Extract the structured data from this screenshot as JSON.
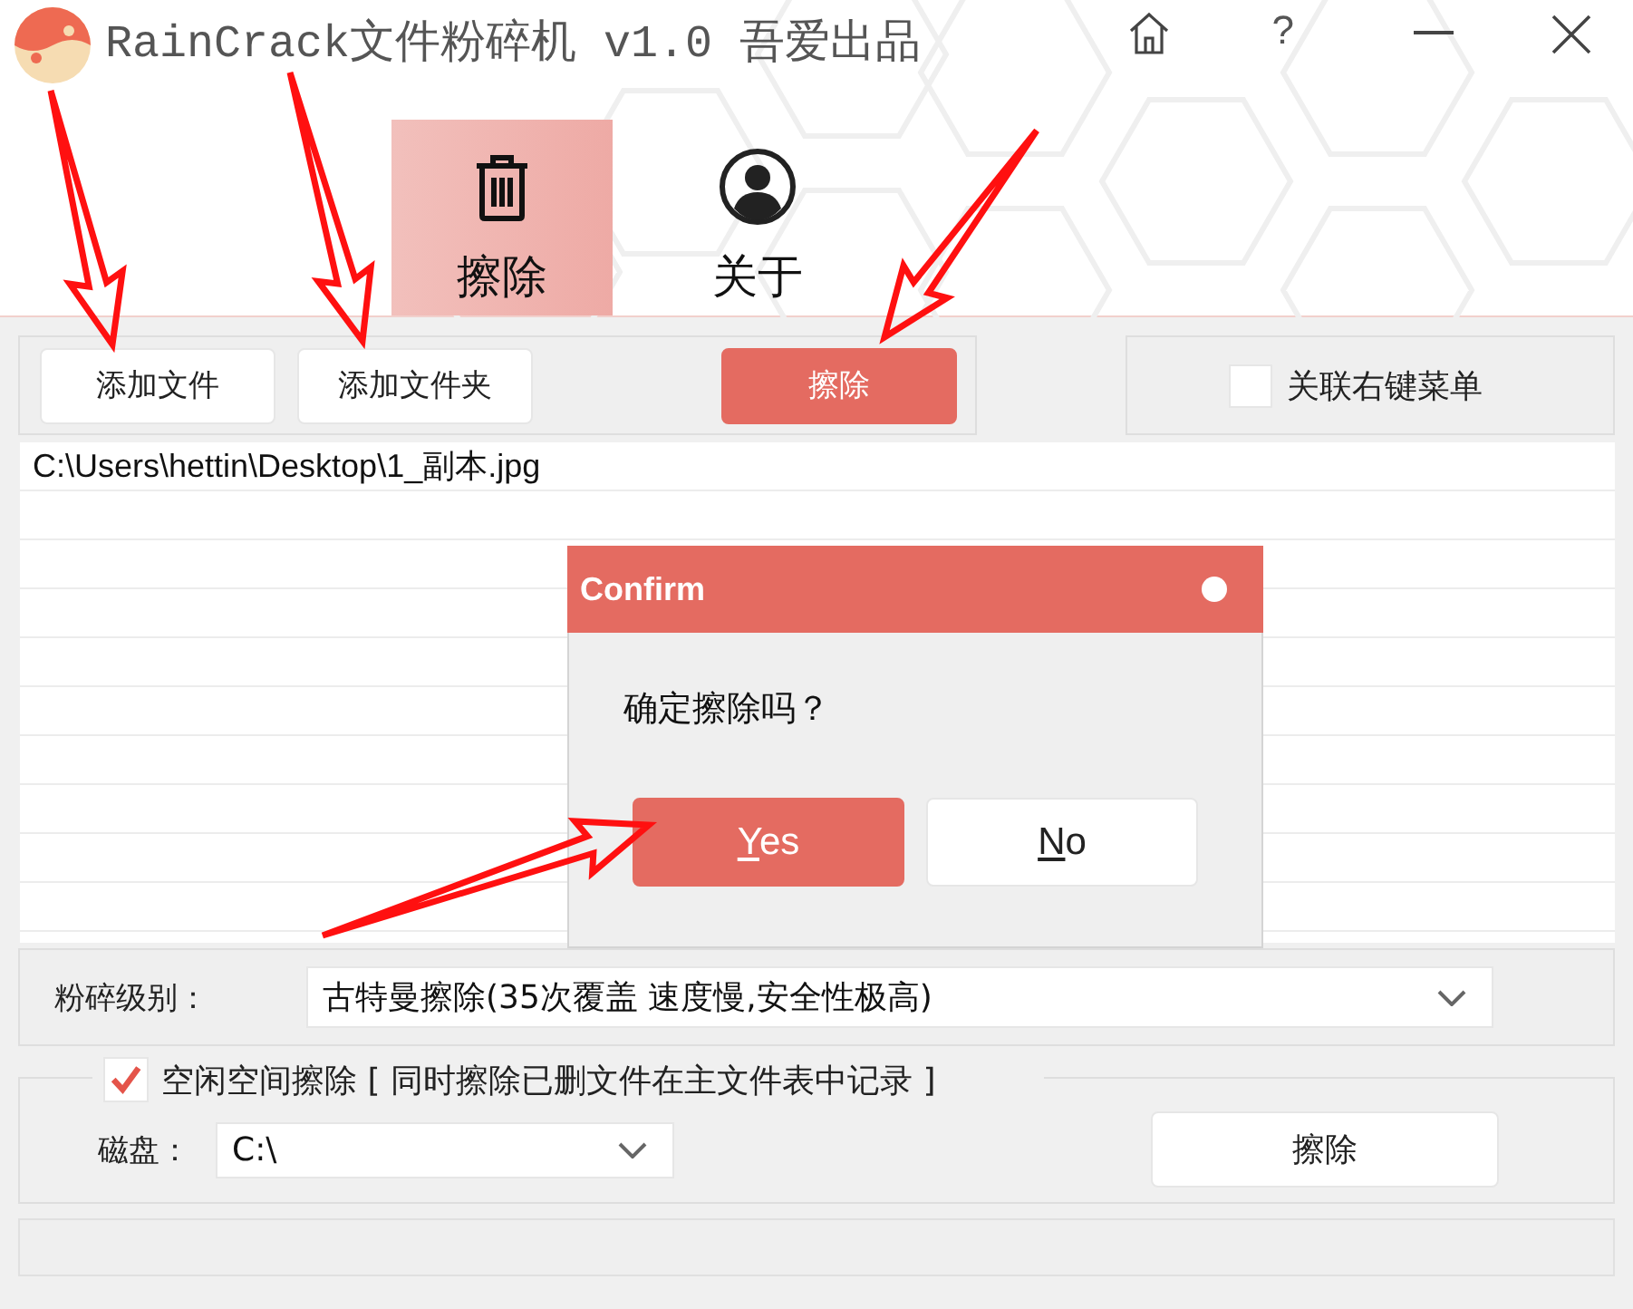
{
  "window": {
    "title": "RainCrack文件粉碎机 v1.0 吾爱出品",
    "controls": [
      {
        "kind": "home"
      },
      {
        "kind": "help",
        "text": "?"
      },
      {
        "kind": "minimize"
      },
      {
        "kind": "close"
      }
    ]
  },
  "tabs": [
    {
      "kind": "trash",
      "label": "擦除",
      "selected": true
    },
    {
      "kind": "user",
      "label": "关于",
      "selected": false
    }
  ],
  "toolbar": {
    "buttons": [
      {
        "kind": "normal",
        "label": "添加文件"
      },
      {
        "kind": "normal",
        "label": "添加文件夹"
      },
      {
        "kind": "primary",
        "label": "擦除"
      }
    ]
  },
  "context_menu": {
    "label": "关联右键菜单",
    "checked": false
  },
  "file_list": {
    "rows": [
      "C:\\Users\\hettin\\Desktop\\1_副本.jpg"
    ]
  },
  "shred_level": {
    "label": "粉碎级别：",
    "value": "古特曼擦除(35次覆盖 速度慢,安全性极高)"
  },
  "free_space": {
    "checked": true,
    "label": "空闲空间擦除 [ 同时擦除已删文件在主文件表中记录 ]",
    "disk_label": "磁盘：",
    "disk_value": "C:\\",
    "button": "擦除"
  },
  "dialog": {
    "title": "Confirm",
    "message": "确定擦除吗？",
    "buttons": [
      {
        "kind": "primary",
        "label": "Yes"
      },
      {
        "kind": "normal",
        "label": "No"
      }
    ]
  }
}
